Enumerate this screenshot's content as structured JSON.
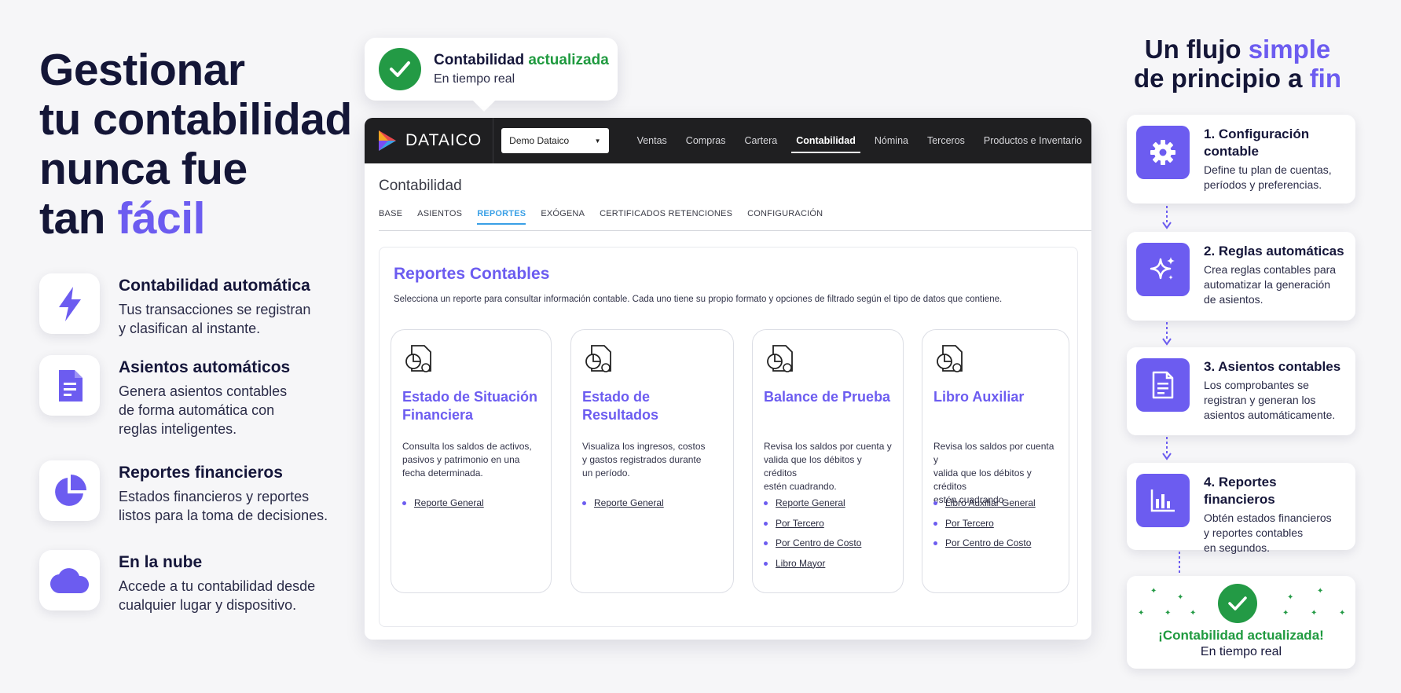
{
  "hero": {
    "line1": "Gestionar",
    "line2": "tu contabilidad",
    "line3": "nunca fue",
    "line4_prefix": "tan ",
    "line4_accent": "fácil"
  },
  "features": [
    {
      "title": "Contabilidad automática",
      "desc": "Tus transacciones se registran\ny clasifican al instante.",
      "icon": "lightning-icon"
    },
    {
      "title": "Asientos automáticos",
      "desc": "Genera asientos contables\nde forma automática con\nreglas inteligentes.",
      "icon": "document-icon"
    },
    {
      "title": "Reportes financieros",
      "desc": "Estados financieros y reportes\nlistos para la toma de decisiones.",
      "icon": "pie-chart-icon"
    },
    {
      "title": "En la nube",
      "desc": "Accede a tu contabilidad desde\ncualquier lugar y dispositivo.",
      "icon": "cloud-icon"
    }
  ],
  "bubble": {
    "title": "Contabilidad",
    "title_accent": "actualizada",
    "subtitle": "En tiempo real"
  },
  "app": {
    "brand": "DATAICO",
    "company_select": "Demo Dataico",
    "nav": [
      "Ventas",
      "Compras",
      "Cartera",
      "Contabilidad",
      "Nómina",
      "Terceros",
      "Productos e Inventario"
    ],
    "nav_active": "Contabilidad",
    "page_title": "Contabilidad",
    "subtabs": [
      "BASE",
      "ASIENTOS",
      "REPORTES",
      "EXÓGENA",
      "CERTIFICADOS RETENCIONES",
      "CONFIGURACIÓN"
    ],
    "subtab_active": "REPORTES",
    "panel_title": "Reportes Contables",
    "panel_desc": "Selecciona un reporte para consultar información contable. Cada uno tiene su propio formato y opciones de filtrado según el tipo de datos que contiene.",
    "reports": [
      {
        "title": "Estado de Situación Financiera",
        "desc": "Consulta los saldos de activos,\npasivos y patrimonio en una\nfecha determinada.",
        "links": [
          "Reporte General"
        ]
      },
      {
        "title": "Estado de Resultados",
        "desc": "Visualiza los ingresos, costos\ny gastos registrados durante\nun período.",
        "links": [
          "Reporte General"
        ]
      },
      {
        "title": "Balance de Prueba",
        "desc": "Revisa los saldos por cuenta y\nvalida que los débitos y créditos\nestén cuadrando.",
        "links": [
          "Reporte General",
          "Por Tercero",
          "Por Centro de Costo",
          "Libro Mayor"
        ]
      },
      {
        "title": "Libro Auxiliar",
        "desc": "Revisa los saldos por cuenta y\nvalida que los débitos y créditos\nestén cuadrando.",
        "links": [
          "Libro Auxiliar General",
          "Por Tercero",
          "Por Centro de Costo"
        ]
      }
    ]
  },
  "flow": {
    "title_line1_prefix": "Un flujo ",
    "title_line1_accent": "simple",
    "title_line2_prefix": "de principio a ",
    "title_line2_accent": "fin",
    "steps": [
      {
        "title": "1. Configuración contable",
        "desc": "Define tu plan de cuentas,\nperíodos y preferencias.",
        "icon": "gear-icon"
      },
      {
        "title": "2. Reglas automáticas",
        "desc": "Crea reglas contables para\nautomatizar la generación\nde asientos.",
        "icon": "sparkle-icon"
      },
      {
        "title": "3. Asientos contables",
        "desc": "Los comprobantes se\nregistran y generan los\nasientos automáticamente.",
        "icon": "document-icon"
      },
      {
        "title": "4. Reportes financieros",
        "desc": "Obtén estados financieros\ny reportes contables\nen segundos.",
        "icon": "bar-chart-icon"
      }
    ],
    "final_title": "¡Contabilidad actualizada!",
    "final_sub": "En tiempo real"
  },
  "colors": {
    "accent": "#6c5cf0",
    "success": "#239a45",
    "navbar": "#1f1f21",
    "tab_active": "#3aa0e6"
  }
}
